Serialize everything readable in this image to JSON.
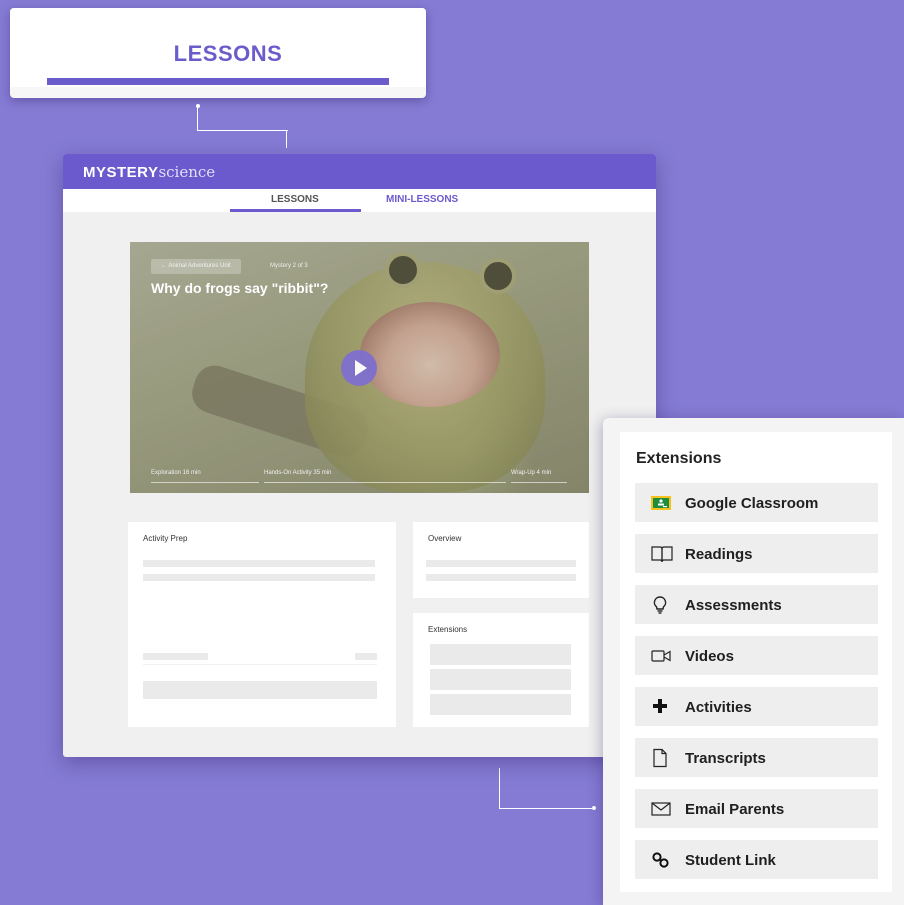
{
  "callout": {
    "label": "LESSONS"
  },
  "app": {
    "logo_bold": "MYSTERY",
    "logo_light": "science",
    "tabs": [
      {
        "label": "LESSONS",
        "active": true
      },
      {
        "label": "MINI-LESSONS",
        "active": false
      }
    ],
    "hero": {
      "breadcrumb": "←   Animal Adventures Unit",
      "mystery_count": "Mystery 2 of 3",
      "title": "Why do frogs say \"ribbit\"?",
      "segments": [
        {
          "label": "Exploration 16 min"
        },
        {
          "label": "Hands-On Activity 35 min"
        },
        {
          "label": "Wrap-Up 4 min"
        }
      ]
    },
    "cards": {
      "activity_prep": "Activity Prep",
      "overview": "Overview",
      "extensions": "Extensions"
    }
  },
  "extensions_panel": {
    "title": "Extensions",
    "items": [
      {
        "label": "Google Classroom",
        "icon": "google-classroom-icon"
      },
      {
        "label": "Readings",
        "icon": "book-icon"
      },
      {
        "label": "Assessments",
        "icon": "lightbulb-icon"
      },
      {
        "label": "Videos",
        "icon": "video-camera-icon"
      },
      {
        "label": "Activities",
        "icon": "plus-icon"
      },
      {
        "label": "Transcripts",
        "icon": "document-icon"
      },
      {
        "label": "Email Parents",
        "icon": "envelope-icon"
      },
      {
        "label": "Student Link",
        "icon": "link-icon"
      }
    ],
    "colors": {
      "accent": "#6a5acd",
      "background": "#857bd4",
      "google_green": "#1e8e3e",
      "google_yellow": "#f9c11b"
    }
  }
}
